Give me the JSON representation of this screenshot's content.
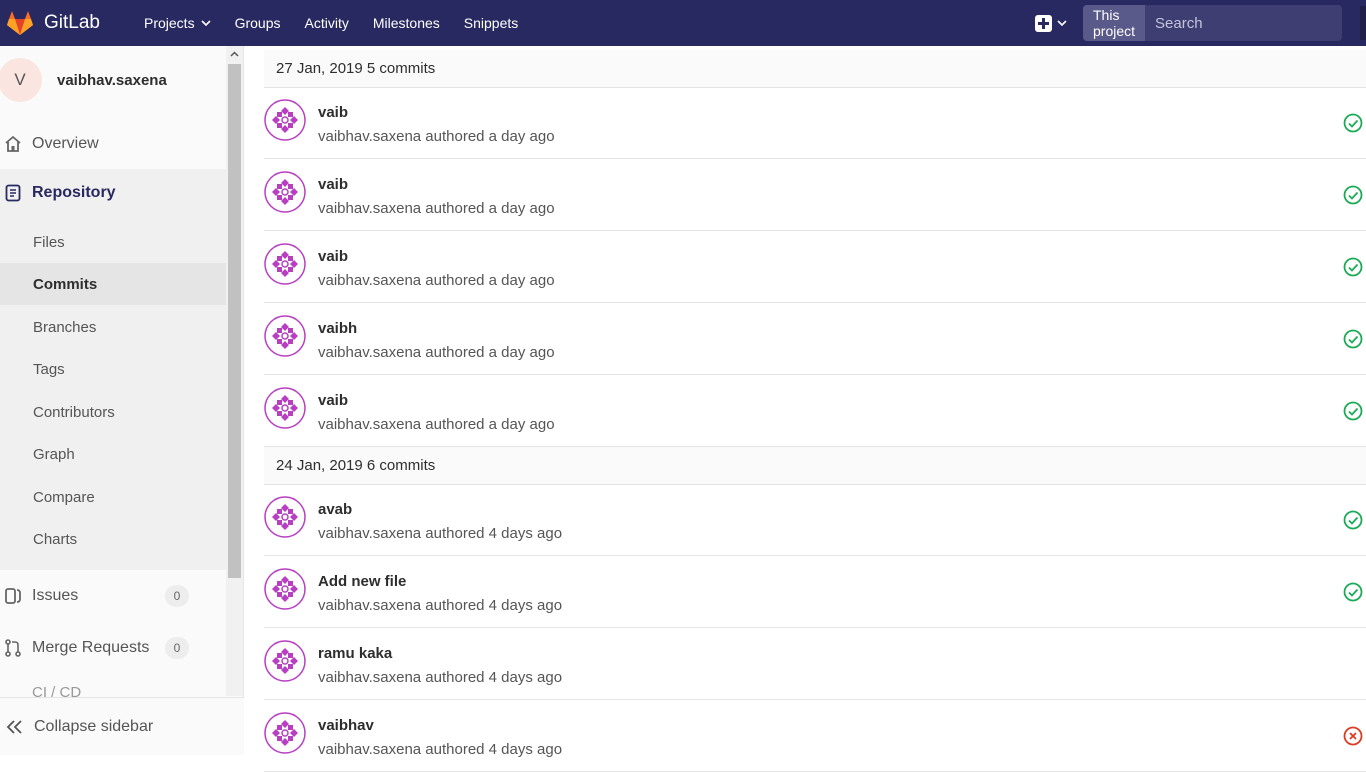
{
  "navbar": {
    "brand": "GitLab",
    "items": [
      "Projects",
      "Groups",
      "Activity",
      "Milestones",
      "Snippets"
    ],
    "search_scope": "This project",
    "search_placeholder": "Search"
  },
  "sidebar": {
    "project_initial": "V",
    "project_name": "vaibhav.saxena",
    "overview": "Overview",
    "repository": "Repository",
    "repo_items": [
      "Files",
      "Commits",
      "Branches",
      "Tags",
      "Contributors",
      "Graph",
      "Compare",
      "Charts"
    ],
    "active_item": "Commits",
    "issues": {
      "label": "Issues",
      "count": "0"
    },
    "merge_requests": {
      "label": "Merge Requests",
      "count": "0"
    },
    "faded_item": "CI / CD",
    "collapse": "Collapse sidebar"
  },
  "commit_groups": [
    {
      "date": "27 Jan, 2019 5 commits",
      "commits": [
        {
          "title": "vaib",
          "meta": "vaibhav.saxena authored a day ago",
          "status": "passed"
        },
        {
          "title": "vaib",
          "meta": "vaibhav.saxena authored a day ago",
          "status": "passed"
        },
        {
          "title": "vaib",
          "meta": "vaibhav.saxena authored a day ago",
          "status": "passed"
        },
        {
          "title": "vaibh",
          "meta": "vaibhav.saxena authored a day ago",
          "status": "passed"
        },
        {
          "title": "vaib",
          "meta": "vaibhav.saxena authored a day ago",
          "status": "passed"
        }
      ]
    },
    {
      "date": "24 Jan, 2019 6 commits",
      "commits": [
        {
          "title": "avab",
          "meta": "vaibhav.saxena authored 4 days ago",
          "status": "passed"
        },
        {
          "title": "Add new file",
          "meta": "vaibhav.saxena authored 4 days ago",
          "status": "passed"
        },
        {
          "title": "ramu kaka",
          "meta": "vaibhav.saxena authored 4 days ago",
          "status": "none"
        },
        {
          "title": "vaibhav",
          "meta": "vaibhav.saxena authored 4 days ago",
          "status": "failed"
        }
      ]
    }
  ],
  "colors": {
    "navbar": "#292961",
    "passed": "#1aaa55",
    "failed": "#db3b21",
    "avatar": "#b83ec2"
  },
  "icons": [
    "gitlab-logo-icon",
    "chevron-down-icon",
    "plus-square-icon",
    "search-icon",
    "home-icon",
    "repository-doc-icon",
    "issues-icon",
    "merge-request-icon",
    "double-chevron-left-icon",
    "check-circle-icon",
    "x-circle-icon",
    "identicon-avatar"
  ]
}
